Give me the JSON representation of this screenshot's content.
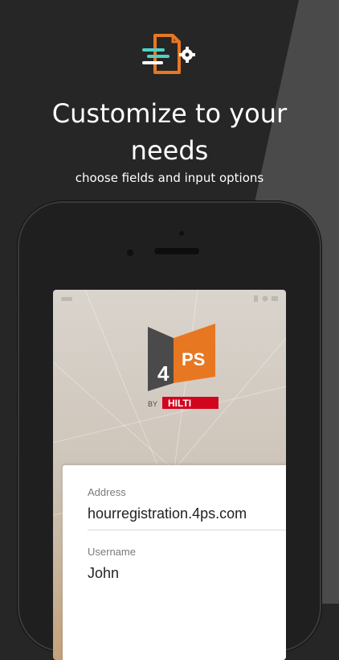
{
  "headline": "Customize to your needs",
  "headline_line1": "Customize to your",
  "headline_line2": "needs",
  "subheadline": "choose fields and input options",
  "app_logo": {
    "mark_text": "4",
    "ps_text": "PS",
    "by_text": "BY",
    "brand_text": "HILTI"
  },
  "form": {
    "address_label": "Address",
    "address_value": "hourregistration.4ps.com",
    "username_label": "Username",
    "username_value": "John"
  },
  "colors": {
    "background_dark": "#262626",
    "background_diagonal": "#4a4a4a",
    "accent_orange": "#e87722",
    "accent_teal": "#4fd1c5",
    "hilti_red": "#d2051e"
  },
  "icons": {
    "hero": "document-settings-icon"
  }
}
